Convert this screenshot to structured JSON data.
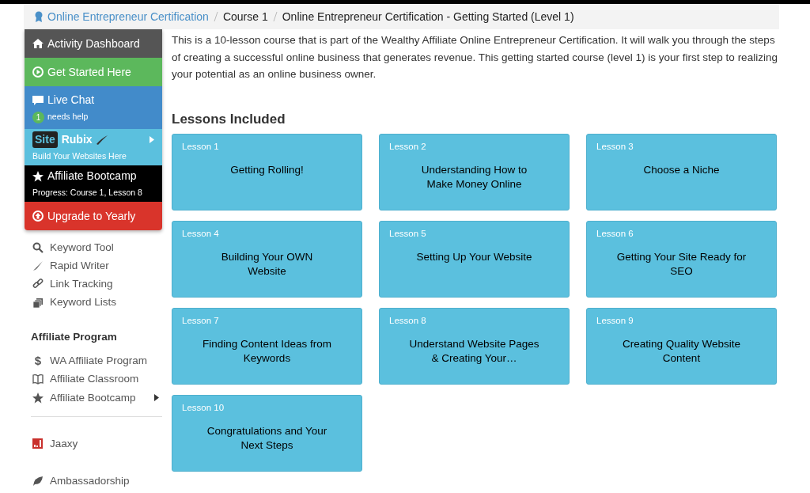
{
  "breadcrumb": [
    {
      "label": "Online Entrepreneur Certification",
      "link": true
    },
    {
      "label": "Course 1",
      "link": false
    },
    {
      "label": "Online Entrepreneur Certification - Getting Started (Level 1)",
      "link": false
    }
  ],
  "menu": [
    {
      "kind": "plain",
      "label": "Activity Dashboard",
      "color": "#555555"
    },
    {
      "kind": "plain",
      "label": "Get Started Here",
      "color": "#5cb85c"
    },
    {
      "kind": "chat",
      "label": "Live Chat",
      "badge": "1",
      "sub": "needs help",
      "color": "#428bca"
    },
    {
      "kind": "logo",
      "logo_a": "Site",
      "logo_b": "Rubix",
      "sub": "Build Your Websites Here",
      "color": "#5bc0de"
    },
    {
      "kind": "sub",
      "label": "Affiliate Bootcamp",
      "sub": "Progress: Course 1, Lesson 8",
      "color": "#000000"
    },
    {
      "kind": "plain",
      "label": "Upgrade to Yearly",
      "color": "#d9342b"
    }
  ],
  "sidebar": [
    {
      "kind": "item",
      "label": "Keyword Tool"
    },
    {
      "kind": "item",
      "label": "Rapid Writer"
    },
    {
      "kind": "item",
      "label": "Link Tracking"
    },
    {
      "kind": "item",
      "label": "Keyword Lists"
    },
    {
      "kind": "heading",
      "label": "Affiliate Program"
    },
    {
      "kind": "item",
      "label": "WA Affiliate Program",
      "glyph": "$"
    },
    {
      "kind": "item",
      "label": "Affiliate Classroom"
    },
    {
      "kind": "item",
      "label": "Affiliate Bootcamp",
      "caret": true
    },
    {
      "kind": "divider"
    },
    {
      "kind": "item",
      "label": "Jaaxy"
    },
    {
      "kind": "item",
      "label": "Ambassadorship"
    }
  ],
  "intro": "This is a 10-lesson course that is part of the Wealthy Affiliate Online Entrepreneur Certification. It will walk you through the steps of creating a successful online business that generates revenue. This getting started course (level 1) is your first step to realizing your potential as an online business owner.",
  "lessons_heading": "Lessons Included",
  "lessons": [
    {
      "number": "Lesson 1",
      "title": "Getting Rolling!"
    },
    {
      "number": "Lesson 2",
      "title": "Understanding How to Make Money Online"
    },
    {
      "number": "Lesson 3",
      "title": "Choose a Niche"
    },
    {
      "number": "Lesson 4",
      "title": "Building Your OWN Website"
    },
    {
      "number": "Lesson 5",
      "title": "Setting Up Your Website"
    },
    {
      "number": "Lesson 6",
      "title": "Getting Your Site Ready for SEO"
    },
    {
      "number": "Lesson 7",
      "title": "Finding Content Ideas from Keywords"
    },
    {
      "number": "Lesson 8",
      "title": "Understand Website Pages & Creating Your…"
    },
    {
      "number": "Lesson 9",
      "title": "Creating Quality Website Content"
    },
    {
      "number": "Lesson 10",
      "title": "Congratulations and Your Next Steps"
    }
  ]
}
